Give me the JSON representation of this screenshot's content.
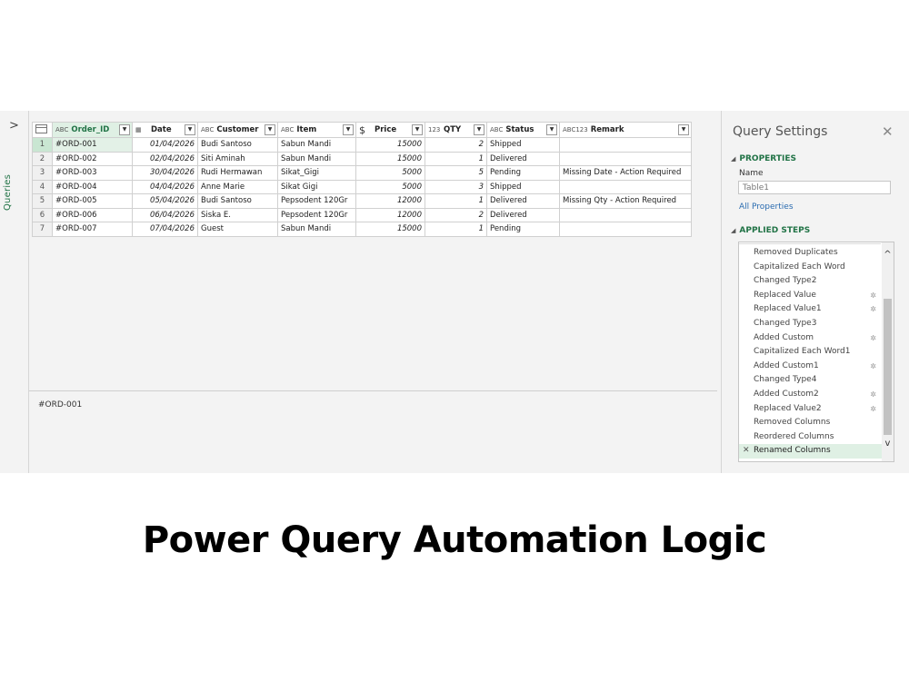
{
  "rail": {
    "expand_glyph": ">",
    "label": "Queries"
  },
  "table": {
    "columns": [
      {
        "type_icon": "ABC",
        "name": "Order_ID"
      },
      {
        "type_icon": "date",
        "name": "Date"
      },
      {
        "type_icon": "ABC",
        "name": "Customer"
      },
      {
        "type_icon": "ABC",
        "name": "Item"
      },
      {
        "type_icon": "$",
        "name": "Price"
      },
      {
        "type_icon": "123",
        "name": "QTY"
      },
      {
        "type_icon": "ABC",
        "name": "Status"
      },
      {
        "type_icon": "ABC123",
        "name": "Remark"
      }
    ],
    "rows": [
      {
        "n": "1",
        "id": "#ORD-001",
        "date": "01/04/2026",
        "customer": "Budi Santoso",
        "item": "Sabun Mandi",
        "price": "15000",
        "qty": "2",
        "status": "Shipped",
        "remark": ""
      },
      {
        "n": "2",
        "id": "#ORD-002",
        "date": "02/04/2026",
        "customer": "Siti Aminah",
        "item": "Sabun Mandi",
        "price": "15000",
        "qty": "1",
        "status": "Delivered",
        "remark": ""
      },
      {
        "n": "3",
        "id": "#ORD-003",
        "date": "30/04/2026",
        "customer": "Rudi Hermawan",
        "item": "Sikat_Gigi",
        "price": "5000",
        "qty": "5",
        "status": "Pending",
        "remark": "Missing Date - Action Required"
      },
      {
        "n": "4",
        "id": "#ORD-004",
        "date": "04/04/2026",
        "customer": "Anne Marie",
        "item": "Sikat Gigi",
        "price": "5000",
        "qty": "3",
        "status": "Shipped",
        "remark": ""
      },
      {
        "n": "5",
        "id": "#ORD-005",
        "date": "05/04/2026",
        "customer": "Budi Santoso",
        "item": "Pepsodent 120Gr",
        "price": "12000",
        "qty": "1",
        "status": "Delivered",
        "remark": "Missing Qty - Action Required"
      },
      {
        "n": "6",
        "id": "#ORD-006",
        "date": "06/04/2026",
        "customer": "Siska E.",
        "item": "Pepsodent 120Gr",
        "price": "12000",
        "qty": "2",
        "status": "Delivered",
        "remark": ""
      },
      {
        "n": "7",
        "id": "#ORD-007",
        "date": "07/04/2026",
        "customer": "Guest",
        "item": "Sabun Mandi",
        "price": "15000",
        "qty": "1",
        "status": "Pending",
        "remark": ""
      }
    ]
  },
  "preview": {
    "value": "#ORD-001"
  },
  "settings": {
    "title": "Query Settings",
    "close_glyph": "✕",
    "properties_label": "PROPERTIES",
    "name_label": "Name",
    "name_value": "Table1",
    "all_properties": "All Properties",
    "applied_steps_label": "APPLIED STEPS",
    "steps": [
      {
        "label": "Removed Duplicates",
        "gear": false
      },
      {
        "label": "Capitalized Each Word",
        "gear": false
      },
      {
        "label": "Changed Type2",
        "gear": false
      },
      {
        "label": "Replaced Value",
        "gear": true
      },
      {
        "label": "Replaced Value1",
        "gear": true
      },
      {
        "label": "Changed Type3",
        "gear": false
      },
      {
        "label": "Added Custom",
        "gear": true
      },
      {
        "label": "Capitalized Each Word1",
        "gear": false
      },
      {
        "label": "Added Custom1",
        "gear": true
      },
      {
        "label": "Changed Type4",
        "gear": false
      },
      {
        "label": "Added Custom2",
        "gear": true
      },
      {
        "label": "Replaced Value2",
        "gear": true
      },
      {
        "label": "Removed Columns",
        "gear": false
      },
      {
        "label": "Reordered Columns",
        "gear": false
      },
      {
        "label": "Renamed Columns",
        "gear": false,
        "active": true
      }
    ]
  },
  "caption": "Power Query Automation Logic",
  "colors": {
    "accent": "#217346",
    "link": "#2b6cb0",
    "selection": "#dff0e4"
  }
}
